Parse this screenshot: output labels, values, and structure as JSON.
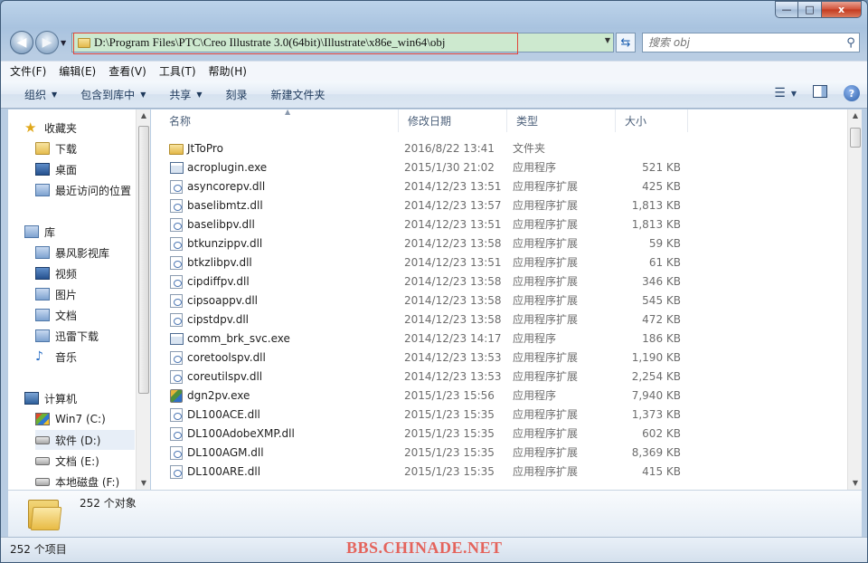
{
  "window": {
    "controls": {
      "minimize": "—",
      "maximize": "□",
      "close": "x"
    }
  },
  "address_bar": {
    "path": "D:\\Program Files\\PTC\\Creo Illustrate 3.0(64bit)\\Illustrate\\x86e_win64\\obj",
    "search_placeholder": "搜索 obj"
  },
  "menu": [
    "文件(F)",
    "编辑(E)",
    "查看(V)",
    "工具(T)",
    "帮助(H)"
  ],
  "toolbar": {
    "organize": "组织",
    "include_library": "包含到库中",
    "share": "共享",
    "burn": "刻录",
    "new_folder": "新建文件夹"
  },
  "nav_pane": {
    "favorites": {
      "label": "收藏夹",
      "items": [
        "下载",
        "桌面",
        "最近访问的位置"
      ]
    },
    "libraries": {
      "label": "库",
      "items": [
        "暴风影视库",
        "视频",
        "图片",
        "文档",
        "迅雷下载",
        "音乐"
      ]
    },
    "computer": {
      "label": "计算机",
      "items": [
        "Win7 (C:)",
        "软件 (D:)",
        "文档 (E:)",
        "本地磁盘 (F:)"
      ],
      "selected": "软件 (D:)"
    }
  },
  "columns": {
    "name": "名称",
    "modified": "修改日期",
    "type": "类型",
    "size": "大小"
  },
  "files": [
    {
      "name": "JtToPro",
      "date": "2016/8/22 13:41",
      "type": "文件夹",
      "size": "",
      "icon": "folder-icon"
    },
    {
      "name": "acroplugin.exe",
      "date": "2015/1/30 21:02",
      "type": "应用程序",
      "size": "521 KB",
      "icon": "exe-icon"
    },
    {
      "name": "asyncorepv.dll",
      "date": "2014/12/23 13:51",
      "type": "应用程序扩展",
      "size": "425 KB",
      "icon": "dll-icon"
    },
    {
      "name": "baselibmtz.dll",
      "date": "2014/12/23 13:57",
      "type": "应用程序扩展",
      "size": "1,813 KB",
      "icon": "dll-icon"
    },
    {
      "name": "baselibpv.dll",
      "date": "2014/12/23 13:51",
      "type": "应用程序扩展",
      "size": "1,813 KB",
      "icon": "dll-icon"
    },
    {
      "name": "btkunzippv.dll",
      "date": "2014/12/23 13:58",
      "type": "应用程序扩展",
      "size": "59 KB",
      "icon": "dll-icon"
    },
    {
      "name": "btkzlibpv.dll",
      "date": "2014/12/23 13:51",
      "type": "应用程序扩展",
      "size": "61 KB",
      "icon": "dll-icon"
    },
    {
      "name": "cipdiffpv.dll",
      "date": "2014/12/23 13:58",
      "type": "应用程序扩展",
      "size": "346 KB",
      "icon": "dll-icon"
    },
    {
      "name": "cipsoappv.dll",
      "date": "2014/12/23 13:58",
      "type": "应用程序扩展",
      "size": "545 KB",
      "icon": "dll-icon"
    },
    {
      "name": "cipstdpv.dll",
      "date": "2014/12/23 13:58",
      "type": "应用程序扩展",
      "size": "472 KB",
      "icon": "dll-icon"
    },
    {
      "name": "comm_brk_svc.exe",
      "date": "2014/12/23 14:17",
      "type": "应用程序",
      "size": "186 KB",
      "icon": "exe-icon"
    },
    {
      "name": "coretoolspv.dll",
      "date": "2014/12/23 13:53",
      "type": "应用程序扩展",
      "size": "1,190 KB",
      "icon": "dll-icon"
    },
    {
      "name": "coreutilspv.dll",
      "date": "2014/12/23 13:53",
      "type": "应用程序扩展",
      "size": "2,254 KB",
      "icon": "dll-icon"
    },
    {
      "name": "dgn2pv.exe",
      "date": "2015/1/23 15:56",
      "type": "应用程序",
      "size": "7,940 KB",
      "icon": "dgn-app-icon"
    },
    {
      "name": "DL100ACE.dll",
      "date": "2015/1/23 15:35",
      "type": "应用程序扩展",
      "size": "1,373 KB",
      "icon": "dll-icon"
    },
    {
      "name": "DL100AdobeXMP.dll",
      "date": "2015/1/23 15:35",
      "type": "应用程序扩展",
      "size": "602 KB",
      "icon": "dll-icon"
    },
    {
      "name": "DL100AGM.dll",
      "date": "2015/1/23 15:35",
      "type": "应用程序扩展",
      "size": "8,369 KB",
      "icon": "dll-icon"
    },
    {
      "name": "DL100ARE.dll",
      "date": "2015/1/23 15:35",
      "type": "应用程序扩展",
      "size": "415 KB",
      "icon": "dll-icon"
    }
  ],
  "details_pane": {
    "count_text": "252 个对象"
  },
  "status_bar": {
    "count_text": "252 个项目",
    "watermark": "BBS.CHINADE.NET"
  },
  "colors": {
    "address_bg": "#cde9cf",
    "highlight_border": "#e0443b",
    "watermark": "#e4645c"
  }
}
